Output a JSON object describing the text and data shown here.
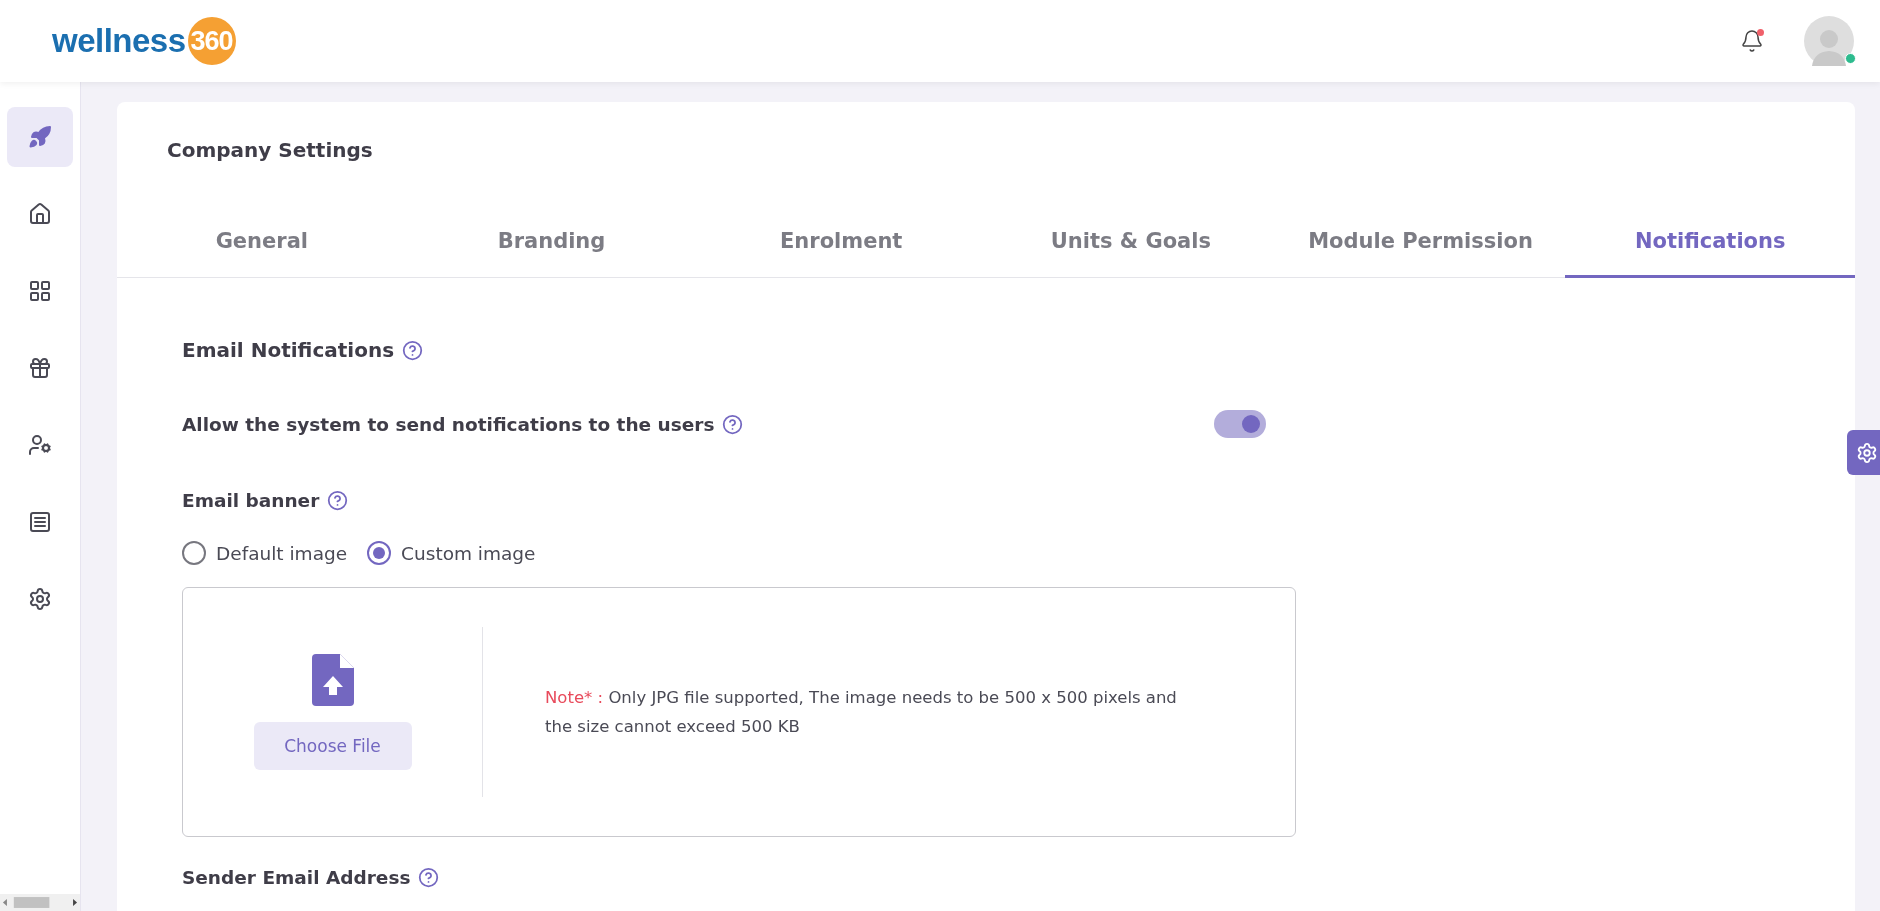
{
  "header": {
    "logo": {
      "word": "wellness",
      "number": "360"
    },
    "bell": {
      "unread": true
    },
    "avatar": {
      "online": true
    }
  },
  "sidebar": {
    "items": [
      {
        "kind": "rocket",
        "selected": true
      },
      {
        "kind": "home",
        "selected": false
      },
      {
        "kind": "grid",
        "selected": false
      },
      {
        "kind": "gift",
        "selected": false
      },
      {
        "kind": "user-settings",
        "selected": false
      },
      {
        "kind": "list",
        "selected": false
      },
      {
        "kind": "settings",
        "selected": false
      }
    ]
  },
  "page": {
    "title": "Company Settings",
    "tabs": [
      {
        "label": "General",
        "selected": false
      },
      {
        "label": "Branding",
        "selected": false
      },
      {
        "label": "Enrolment",
        "selected": false
      },
      {
        "label": "Units & Goals",
        "selected": false
      },
      {
        "label": "Module Permission",
        "selected": false
      },
      {
        "label": "Notifications",
        "selected": true
      }
    ],
    "section_title": "Email Notifications",
    "allow_setting": {
      "label": "Allow the system to send notifications to the users",
      "on": true
    },
    "banner": {
      "label": "Email banner",
      "options": [
        {
          "label": "Default image",
          "selected": false
        },
        {
          "label": "Custom image",
          "selected": true
        }
      ],
      "upload": {
        "button": "Choose File",
        "note_label": "Note* :",
        "note_text": "Only JPG file supported, The image needs to be 500 x 500 pixels and the size cannot exceed 500 KB"
      }
    },
    "sender_label": "Sender Email Address"
  }
}
